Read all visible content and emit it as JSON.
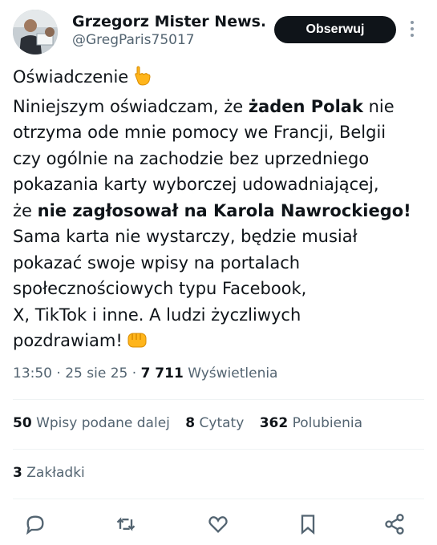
{
  "author": {
    "display_name": "Grzegorz Mister News...",
    "handle": "@GregParis75017",
    "follow_label": "Obserwuj"
  },
  "tweet": {
    "title": "Oświadczenie",
    "line1_pre": "Niniejszym oświadczam, że ",
    "line1_bold": "żaden Polak",
    "line1_post": " nie",
    "line2": "otrzyma ode mnie pomocy we Francji, Belgii",
    "line3": "czy ogólnie na zachodzie bez uprzedniego",
    "line4": "pokazania karty wyborczej udowadniającej,",
    "line5_pre": "że ",
    "line5_bold": "nie zagłosował na Karola Nawrockiego!",
    "line6": "Sama karta nie wystarczy, będzie musiał",
    "line7": "pokazać swoje wpisy na portalach",
    "line8": "społecznościowych typu Facebook,",
    "line9": "X, TikTok i inne. A ludzi życzliwych",
    "line10": "pozdrawiam!"
  },
  "meta": {
    "time": "13:50",
    "date": "25 sie 25",
    "views_count": "7 711",
    "views_label": "Wyświetlenia"
  },
  "stats": {
    "reposts_count": "50",
    "reposts_label": "Wpisy podane dalej",
    "quotes_count": "8",
    "quotes_label": "Cytaty",
    "likes_count": "362",
    "likes_label": "Polubienia",
    "bookmarks_count": "3",
    "bookmarks_label": "Zakładki"
  },
  "icons": {
    "reply": "reply-icon",
    "repost": "repost-icon",
    "like": "heart-icon",
    "bookmark": "bookmark-icon",
    "share": "share-icon"
  },
  "colors": {
    "text": "#0f1419",
    "secondary": "#536471",
    "button_bg": "#0f1419",
    "divider": "#eff3f4"
  }
}
